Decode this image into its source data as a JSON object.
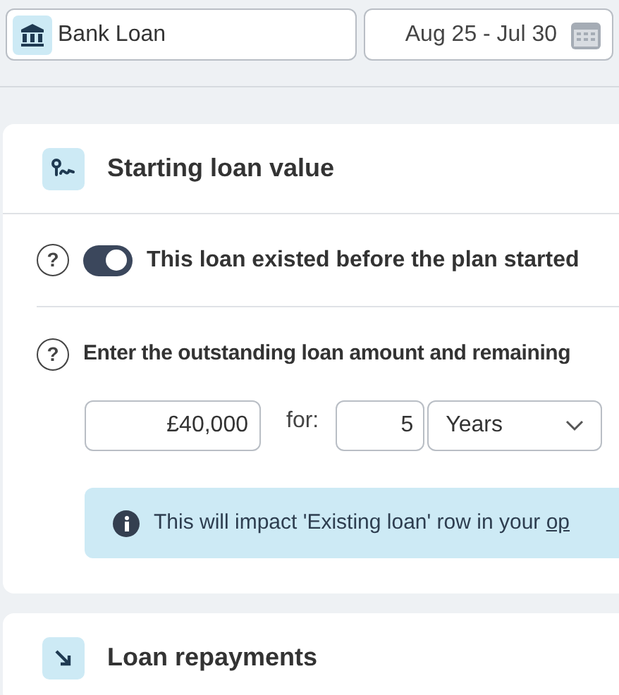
{
  "loan_field": {
    "value": "Bank Loan"
  },
  "date_range": {
    "value": "Aug 25 - Jul 30"
  },
  "sections": [
    {
      "title": "Starting loan value",
      "kind": "start",
      "help_icons": [
        "?",
        "?"
      ],
      "toggle": {
        "label": "This loan existed before the plan started",
        "on": true
      },
      "question": "Enter the outstanding loan amount and remaining",
      "amount": {
        "value": "£40,000"
      },
      "for_label": "for:",
      "term": {
        "value": "5"
      },
      "unit": {
        "value": "Years"
      },
      "info": {
        "text": "This will impact 'Existing loan' row in your ",
        "link": "op"
      }
    },
    {
      "title": "Loan repayments",
      "kind": "repay"
    }
  ]
}
